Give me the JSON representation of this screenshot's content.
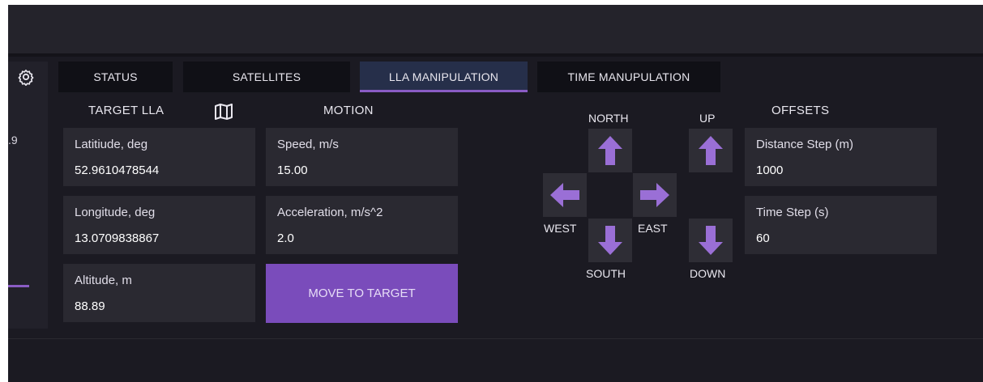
{
  "side": {
    "partial_value": ".9"
  },
  "tabs": [
    {
      "label": "STATUS"
    },
    {
      "label": "SATELLITES"
    },
    {
      "label": "LLA MANIPULATION"
    },
    {
      "label": "TIME MANUPULATION"
    }
  ],
  "active_tab": "LLA MANIPULATION",
  "target": {
    "title": "TARGET LLA",
    "latitude_label": "Latitiude, deg",
    "latitude_value": "52.9610478544",
    "longitude_label": "Longitude, deg",
    "longitude_value": "13.0709838867",
    "altitude_label": "Altitude, m",
    "altitude_value": "88.89"
  },
  "motion": {
    "title": "MOTION",
    "speed_label": "Speed, m/s",
    "speed_value": "15.00",
    "accel_label": "Acceleration, m/s^2",
    "accel_value": "2.0",
    "move_button": "MOVE TO TARGET"
  },
  "directions": {
    "north": "NORTH",
    "south": "SOUTH",
    "west": "WEST",
    "east": "EAST",
    "up": "UP",
    "down": "DOWN"
  },
  "offsets": {
    "title": "OFFSETS",
    "distance_label": "Distance Step (m)",
    "distance_value": "1000",
    "time_label": "Time Step (s)",
    "time_value": "60"
  },
  "icons": {
    "settings": "gear-icon",
    "map": "map-icon",
    "arrows": "arrow-icon"
  },
  "colors": {
    "accent": "#7a4cbb",
    "arrow": "#9a6fd6",
    "background": "#1b1a22",
    "field": "#2a2931"
  }
}
